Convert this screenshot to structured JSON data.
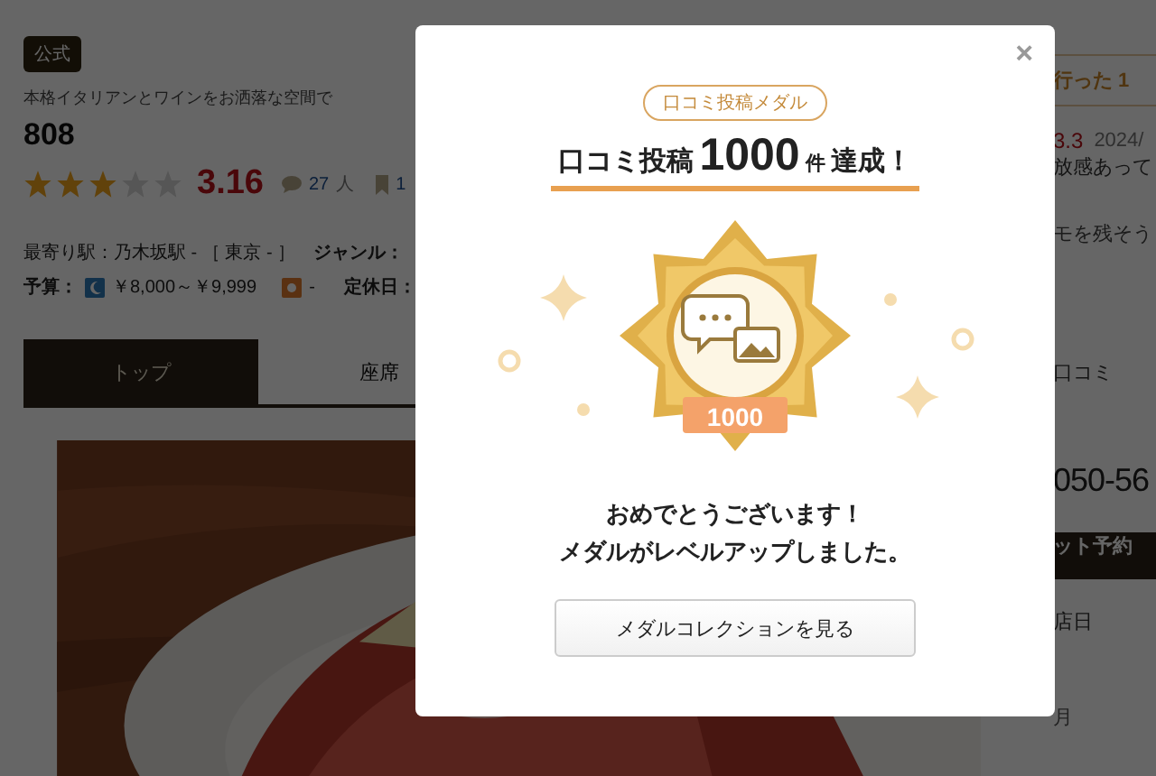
{
  "restaurant": {
    "badge": "公式",
    "tagline": "本格イタリアンとワインをお洒落な空間で",
    "name": "808",
    "stars": 3,
    "score": "3.16",
    "reviews": "27",
    "reviews_unit": "人",
    "bookmarks": "1",
    "station": "最寄り駅：乃木坂駅 - ［ 東京 - ］",
    "genre_label": "ジャンル：",
    "budget_label": "予算：",
    "budget_dinner": "￥8,000～￥9,999",
    "budget_lunch": "-",
    "holiday": "定休日："
  },
  "tabs": [
    {
      "label": "トップ",
      "selected": true
    },
    {
      "label": "座席",
      "selected": false
    }
  ],
  "sidebar": {
    "went": "行った 1",
    "review_score": "3.3",
    "review_date": "2024/",
    "review_text": "放感あって",
    "memo": "モを残そう",
    "reviews_label": "口コミ",
    "phone": "050-56",
    "reserve": "ット予約",
    "date_label": "店日",
    "weekday": "月"
  },
  "modal": {
    "close": "×",
    "category": "口コミ投稿メダル",
    "title_prefix": "口コミ投稿",
    "count": "1000",
    "unit": "件",
    "title_suffix": "達成！",
    "medal_level": "1000",
    "messages": [
      "おめでとうございます！",
      "メダルがレベルアップしました。"
    ],
    "button": "メダルコレクションを見る"
  }
}
